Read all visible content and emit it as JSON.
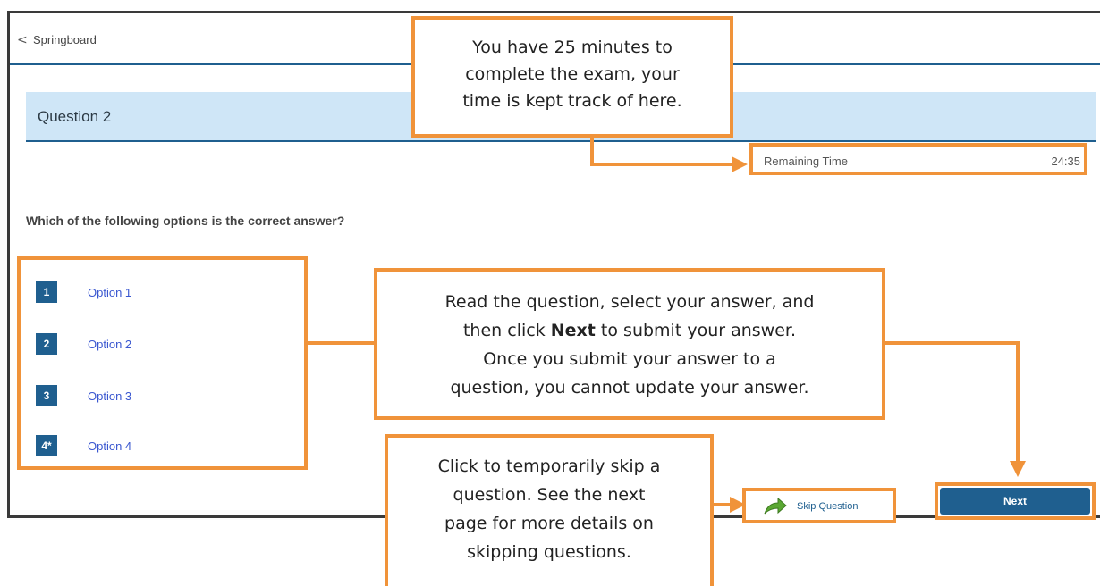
{
  "topbar": {
    "back_glyph": "<",
    "back_label": "Springboard"
  },
  "question": {
    "title": "Question 2",
    "prompt": "Which of the following options is the correct answer?"
  },
  "timer": {
    "label": "Remaining Time",
    "value": "24:35"
  },
  "options": [
    {
      "number": "1",
      "label": "Option 1"
    },
    {
      "number": "2",
      "label": "Option 2"
    },
    {
      "number": "3",
      "label": "Option 3"
    },
    {
      "number": "4*",
      "label": "Option 4"
    }
  ],
  "actions": {
    "skip_label": "Skip Question",
    "skip_icon": "green-arrow-icon",
    "next_label": "Next"
  },
  "callouts": {
    "timer": [
      "You have 25 minutes to",
      "complete the exam, your",
      "time is kept track of here."
    ],
    "answer": {
      "line1": "Read the question, select your answer, and",
      "line2_pre": "then click ",
      "line2_bold": "Next",
      "line2_post": " to submit your answer.",
      "line3": "Once you submit your answer to a",
      "line4": "question, you cannot update your answer."
    },
    "skip": [
      "Click to temporarily skip a",
      "question. See the next",
      "page for more details on",
      "skipping questions."
    ]
  },
  "colors": {
    "accent_orange": "#f0933a",
    "primary_blue": "#1f5f8f",
    "header_bg": "#cfe6f7",
    "option_link": "#3a57d0"
  }
}
